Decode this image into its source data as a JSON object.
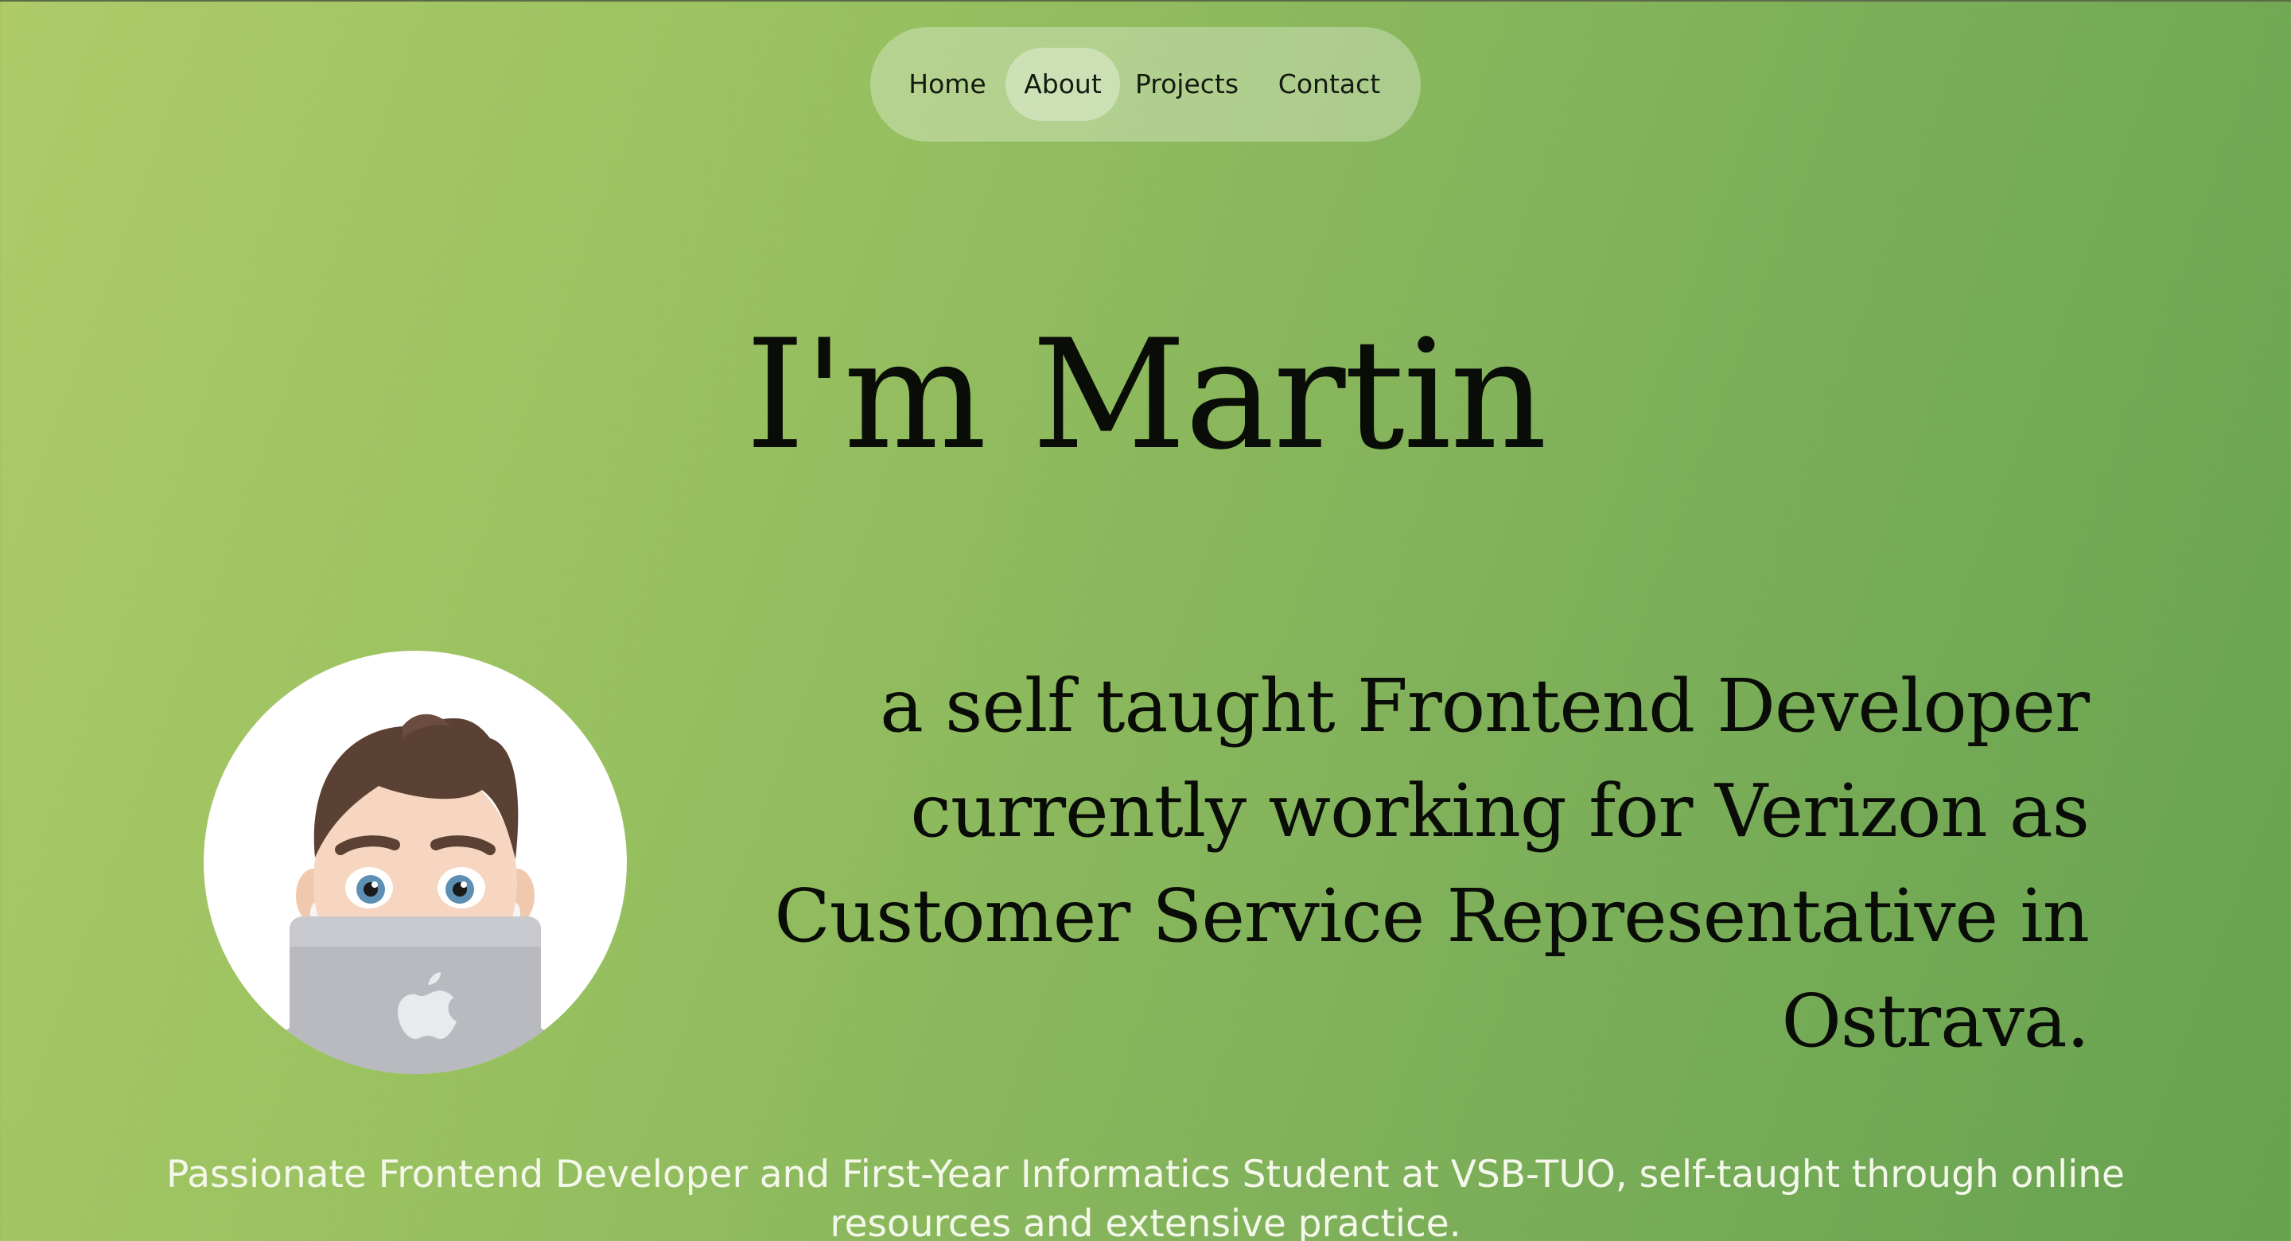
{
  "nav": {
    "items": [
      {
        "label": "Home"
      },
      {
        "label": "About"
      },
      {
        "label": "Projects"
      },
      {
        "label": "Contact"
      }
    ],
    "active": "About"
  },
  "hero": {
    "title": "I'm Martin",
    "tagline": "a self taught Frontend Developer currently working for Verizon as Customer Service Representative in Ostrava.",
    "bio": "Passionate Frontend Developer and First-Year Informatics Student at VSB-TUO, self-taught through online resources and extensive practice."
  },
  "avatar": {
    "icon": "memoji-avatar-icon"
  },
  "colors": {
    "background_start": "#aecb68",
    "background_end": "#66a250",
    "text_dark": "#0a0d07",
    "text_light": "#f4f8ea"
  }
}
